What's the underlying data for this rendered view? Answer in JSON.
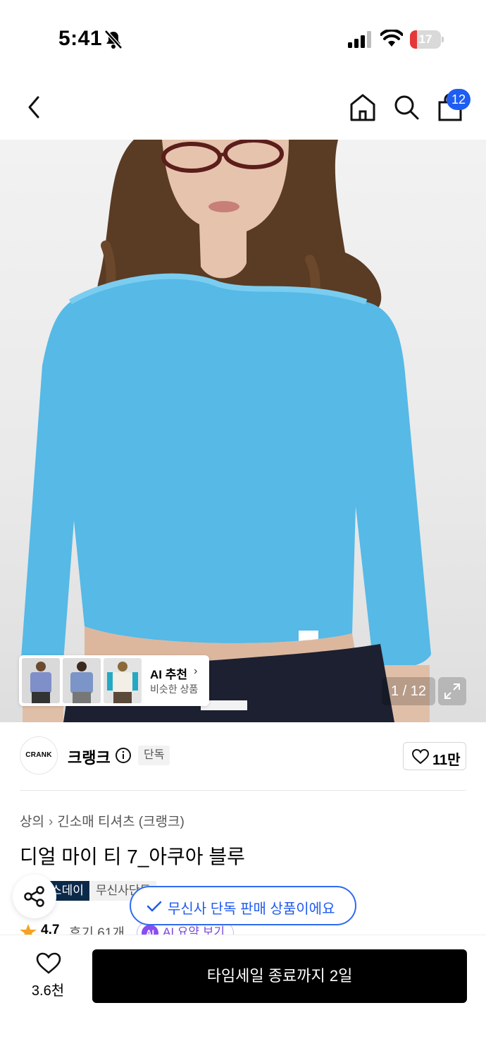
{
  "status_bar": {
    "time": "5:41",
    "battery": "17",
    "icons": [
      "bell-slash-icon",
      "cellular-signal-icon",
      "wifi-icon",
      "battery-icon"
    ]
  },
  "nav": {
    "cart_count": "12",
    "icons": [
      "back-chevron-icon",
      "home-icon",
      "search-icon",
      "shopping-bag-icon"
    ]
  },
  "gallery": {
    "counter": "1 / 12",
    "ai_title": "AI 추천",
    "ai_subtitle": "비슷한 상품",
    "garment_color": "#56b9e6"
  },
  "brand": {
    "logo_text": "CRANK",
    "name": "크랭크",
    "tag": "단독",
    "likes": "11만"
  },
  "breadcrumb": {
    "category": "상의",
    "subcategory": "긴소매 티셔츠 (크랭크)"
  },
  "product": {
    "title": "디얼 마이 티 7_아쿠아 블루"
  },
  "tags": {
    "dark": "스데이",
    "light": "무신사단독"
  },
  "toast": {
    "text": "무신사 단독 판매 상품이에요"
  },
  "rating": {
    "score": "4.7",
    "reviews": "후기 61개",
    "ai_badge": "AI",
    "ai_summary": "AI 요약 보기"
  },
  "bottom_bar": {
    "wish_count": "3.6천",
    "buy_label": "타임세일 종료까지 2일"
  },
  "colors": {
    "accent": "#1d5df2",
    "brand_dark": "#0b2a4a",
    "ai_purple": "#8a4df0"
  }
}
